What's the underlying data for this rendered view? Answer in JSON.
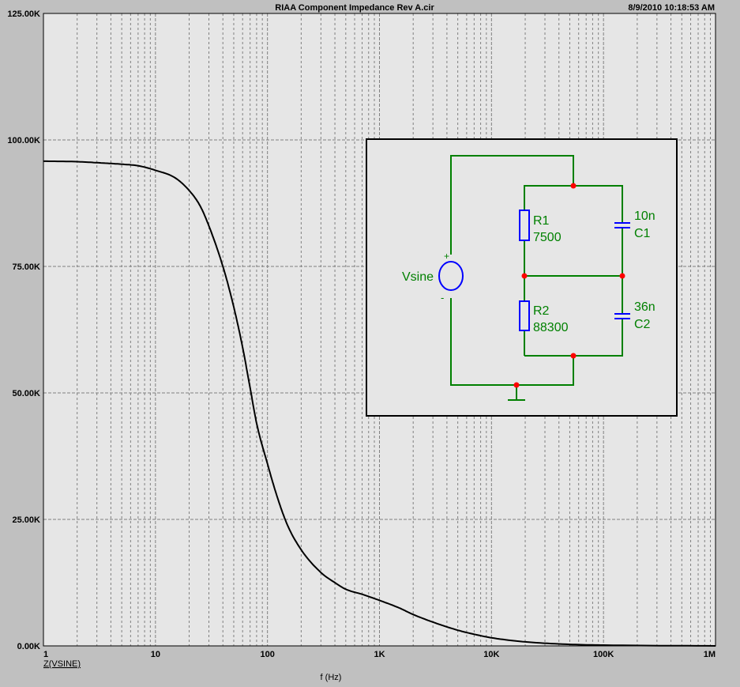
{
  "header": {
    "title": "RIAA Component Impedance Rev A.cir",
    "timestamp": "8/9/2010 10:18:53 AM"
  },
  "chart_data": {
    "type": "line",
    "title": "RIAA Component Impedance Rev A.cir",
    "xlabel": "f (Hz)",
    "ylabel": "",
    "x_scale": "log",
    "xlim": [
      1,
      1000000
    ],
    "ylim": [
      0,
      125000
    ],
    "grid": true,
    "x_ticks": [
      {
        "value": 1,
        "label": "1"
      },
      {
        "value": 10,
        "label": "10"
      },
      {
        "value": 100,
        "label": "100"
      },
      {
        "value": 1000,
        "label": "1K"
      },
      {
        "value": 10000,
        "label": "10K"
      },
      {
        "value": 100000,
        "label": "100K"
      },
      {
        "value": 1000000,
        "label": "1M"
      }
    ],
    "y_ticks": [
      {
        "value": 0,
        "label": "0.00K"
      },
      {
        "value": 25000,
        "label": "25.00K"
      },
      {
        "value": 50000,
        "label": "50.00K"
      },
      {
        "value": 75000,
        "label": "75.00K"
      },
      {
        "value": 100000,
        "label": "100.00K"
      },
      {
        "value": 125000,
        "label": "125.00K"
      }
    ],
    "series": [
      {
        "name": "Z(VSINE)",
        "color": "#000000",
        "x": [
          1,
          2,
          3,
          5,
          7,
          10,
          15,
          20,
          25,
          30,
          40,
          50,
          60,
          70,
          80,
          100,
          120,
          150,
          200,
          300,
          400,
          500,
          700,
          1000,
          1500,
          2000,
          3000,
          5000,
          7000,
          10000,
          20000,
          50000,
          100000,
          1000000
        ],
        "y": [
          95800,
          95700,
          95500,
          95200,
          94900,
          94000,
          92500,
          90000,
          87000,
          83000,
          75000,
          67000,
          59000,
          51000,
          44000,
          36000,
          30000,
          24000,
          19000,
          14500,
          12500,
          11200,
          10200,
          9000,
          7500,
          6200,
          4700,
          3100,
          2300,
          1600,
          800,
          300,
          150,
          0
        ]
      }
    ]
  },
  "schematic": {
    "source": {
      "name": "Vsine",
      "plus": "+",
      "minus": "-"
    },
    "r1": {
      "name": "R1",
      "value": "7500"
    },
    "r2": {
      "name": "R2",
      "value": "88300"
    },
    "c1": {
      "name": "C1",
      "value": "10n"
    },
    "c2": {
      "name": "C2",
      "value": "36n"
    }
  },
  "colors": {
    "background": "#c0c0c0",
    "plot_background": "#e6e6e6",
    "grid": "#808080",
    "trace": "#000000",
    "wire": "#008000",
    "component": "#0000ff",
    "node": "#ff0000"
  }
}
